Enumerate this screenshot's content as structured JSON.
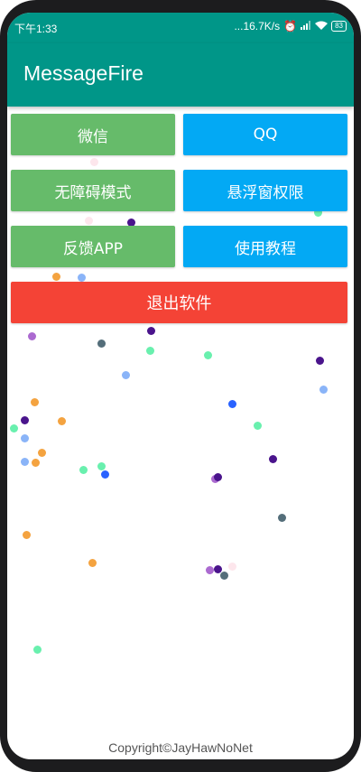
{
  "status": {
    "time": "下午1:33",
    "network_speed": "...16.7K/s",
    "battery": "83"
  },
  "app": {
    "title": "MessageFire"
  },
  "buttons": {
    "wechat": "微信",
    "qq": "QQ",
    "accessibility": "无障碍模式",
    "overlay_permission": "悬浮窗权限",
    "feedback": "反馈APP",
    "tutorial": "使用教程",
    "exit": "退出软件"
  },
  "footer": {
    "copyright": "Copyright©JayHawNoNet"
  },
  "colors": {
    "primary": "#009688",
    "green_button": "#66bb6a",
    "blue_button": "#03a9f4",
    "red_button": "#f44336"
  }
}
